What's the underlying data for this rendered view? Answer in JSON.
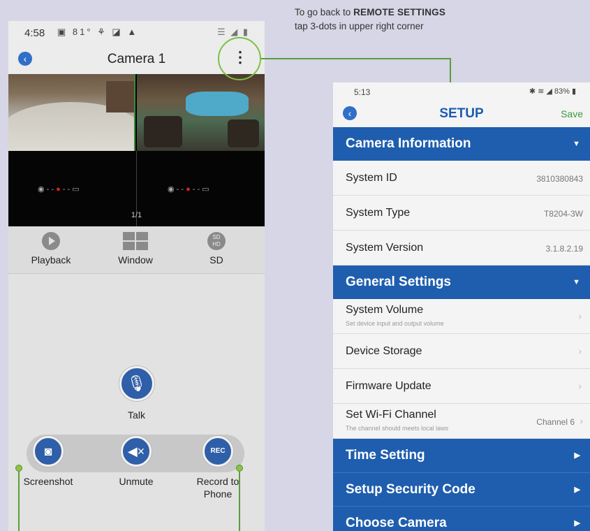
{
  "note": {
    "line1_prefix": "To go back to ",
    "line1_bold": "REMOTE SETTINGS",
    "line2": "tap 3-dots in upper right corner"
  },
  "left_phone": {
    "status": {
      "time": "4:58",
      "icons": "▣ 81° ⚘ ◪ ▲",
      "right_icons": "☰ ◢ ▮"
    },
    "title": "Camera 1",
    "back_icon": "‹",
    "menu_icon": "⋮",
    "page_indicator": "1/1",
    "toolbar": [
      {
        "label": "Playback",
        "icon": "play-circle-icon"
      },
      {
        "label": "Window",
        "icon": "grid-window-icon"
      },
      {
        "label": "SD",
        "icon": "sd-hd-icon"
      }
    ],
    "talk": {
      "label": "Talk",
      "icon": "🎙"
    },
    "actions": [
      {
        "label": "Screenshot",
        "icon": "◙"
      },
      {
        "label": "Unmute",
        "icon": "◀×"
      },
      {
        "label": "Record to Phone",
        "icon": "REC"
      }
    ]
  },
  "right_phone": {
    "status": {
      "time": "5:13",
      "right_icons": "✱ ≋ ◢ 83% ▮"
    },
    "title": "SETUP",
    "save": "Save",
    "back_icon": "‹",
    "sections": [
      {
        "title": "Camera Information",
        "arrow": "▼"
      },
      {
        "title": "General Settings",
        "arrow": "▼"
      },
      {
        "title": "Time Setting",
        "arrow": "▶"
      },
      {
        "title": "Setup Security Code",
        "arrow": "▶"
      },
      {
        "title": "Choose Camera",
        "arrow": "▶"
      }
    ],
    "camera_info": [
      {
        "label": "System ID",
        "value": "3810380843"
      },
      {
        "label": "System Type",
        "value": "T8204-3W"
      },
      {
        "label": "System Version",
        "value": "3.1.8.2.19"
      }
    ],
    "general": [
      {
        "label": "System Volume",
        "sub": "Set device input and output volume"
      },
      {
        "label": "Device Storage"
      },
      {
        "label": "Firmware Update"
      },
      {
        "label": "Set Wi-Fi Channel",
        "sub": "The channel should meets local laws",
        "value": "Channel 6"
      }
    ],
    "chevron": "›"
  }
}
